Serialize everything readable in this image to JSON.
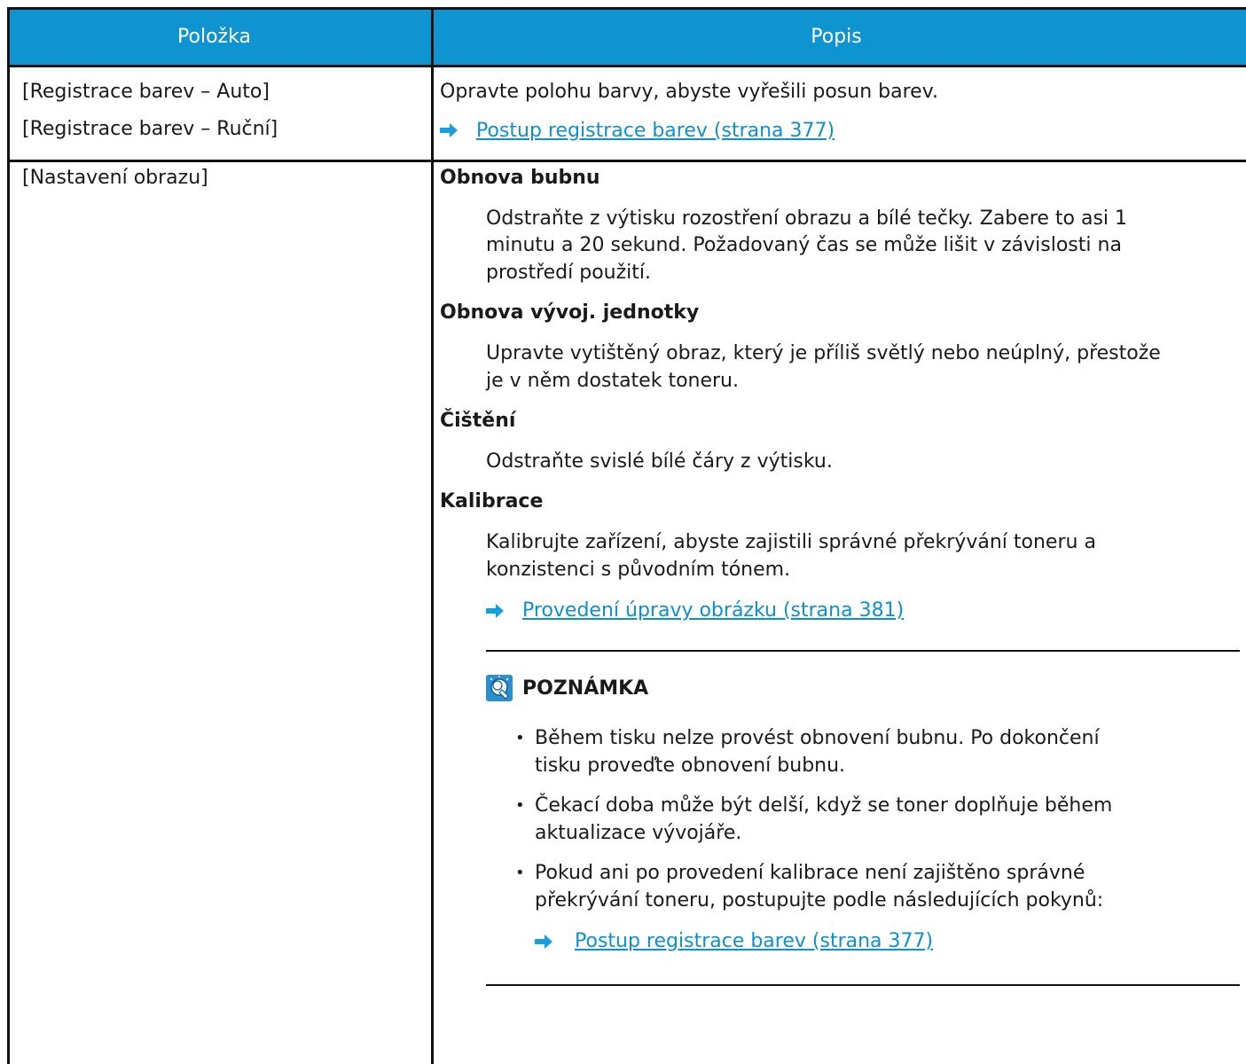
{
  "header": {
    "col_item": "Položka",
    "col_desc": "Popis"
  },
  "row1": {
    "item_line1": "[Registrace barev – Auto]",
    "item_line2": "[Registrace barev – Ruční]",
    "desc": "Opravte polohu barvy, abyste vyřešili posun barev.",
    "link": "Postup registrace barev (strana 377)"
  },
  "row2": {
    "item": "[Nastavení obrazu]",
    "sections": [
      {
        "heading": "Obnova bubnu",
        "text_lines": [
          "Odstraňte z výtisku rozostření obrazu a bílé tečky. Zabere to asi 1",
          "minutu a 20 sekund. Požadovaný čas se může lišit v závislosti na",
          "prostředí použití."
        ]
      },
      {
        "heading": "Obnova vývoj. jednotky",
        "text_lines": [
          "Upravte vytištěný obraz, který je příliš světlý nebo neúplný, přestože",
          "je v něm dostatek toneru."
        ]
      },
      {
        "heading": "Čištění",
        "text_lines": [
          "Odstraňte svislé bílé čáry z výtisku."
        ]
      },
      {
        "heading": "Kalibrace",
        "text_lines": [
          "Kalibrujte zařízení, abyste zajistili správné překrývání toneru a",
          "konzistenci s původním tónem."
        ],
        "link": "Provedení úpravy obrázku (strana 381)"
      }
    ],
    "note": {
      "title": "POZNÁMKA",
      "bullets": [
        {
          "lines": [
            "Během tisku nelze provést obnovení bubnu. Po dokončení",
            "tisku proveďte obnovení bubnu."
          ]
        },
        {
          "lines": [
            "Čekací doba může být delší, když se toner doplňuje během",
            "aktualizace vývojáře."
          ]
        },
        {
          "lines": [
            "Pokud ani po provedení kalibrace není zajištěno správné",
            "překrývání toneru, postupujte podle následujících pokynů:"
          ],
          "link": "Postup registrace barev (strana 377)"
        }
      ]
    }
  },
  "colors": {
    "header_bg": "#0e94d1",
    "link": "#0e8fd0",
    "arrow": "#1a9fde",
    "icon_bg": "#2a8fd0"
  }
}
